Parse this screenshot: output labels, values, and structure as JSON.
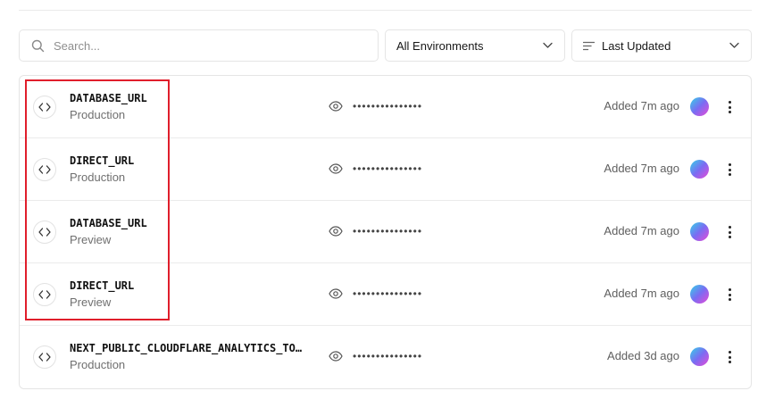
{
  "search": {
    "placeholder": "Search..."
  },
  "filters": {
    "environment_value": "All Environments",
    "sort_value": "Last Updated"
  },
  "env_vars": [
    {
      "name": "DATABASE_URL",
      "environment": "Production",
      "masked_value": "•••••••••••••••",
      "updated": "Added 7m ago"
    },
    {
      "name": "DIRECT_URL",
      "environment": "Production",
      "masked_value": "•••••••••••••••",
      "updated": "Added 7m ago"
    },
    {
      "name": "DATABASE_URL",
      "environment": "Preview",
      "masked_value": "•••••••••••••••",
      "updated": "Added 7m ago"
    },
    {
      "name": "DIRECT_URL",
      "environment": "Preview",
      "masked_value": "•••••••••••••••",
      "updated": "Added 7m ago"
    },
    {
      "name": "NEXT_PUBLIC_CLOUDFLARE_ANALYTICS_TO…",
      "environment": "Production",
      "masked_value": "•••••••••••••••",
      "updated": "Added 3d ago"
    }
  ],
  "colors": {
    "highlight": "#e01e2b",
    "border": "#e5e5e5",
    "muted_text": "#6f6f6f"
  },
  "icons": {
    "search": "search-icon",
    "chevron": "chevron-down-icon",
    "sort": "sort-lines-icon",
    "code": "code-brackets-icon",
    "eye": "eye-icon",
    "more": "more-vertical-icon"
  }
}
